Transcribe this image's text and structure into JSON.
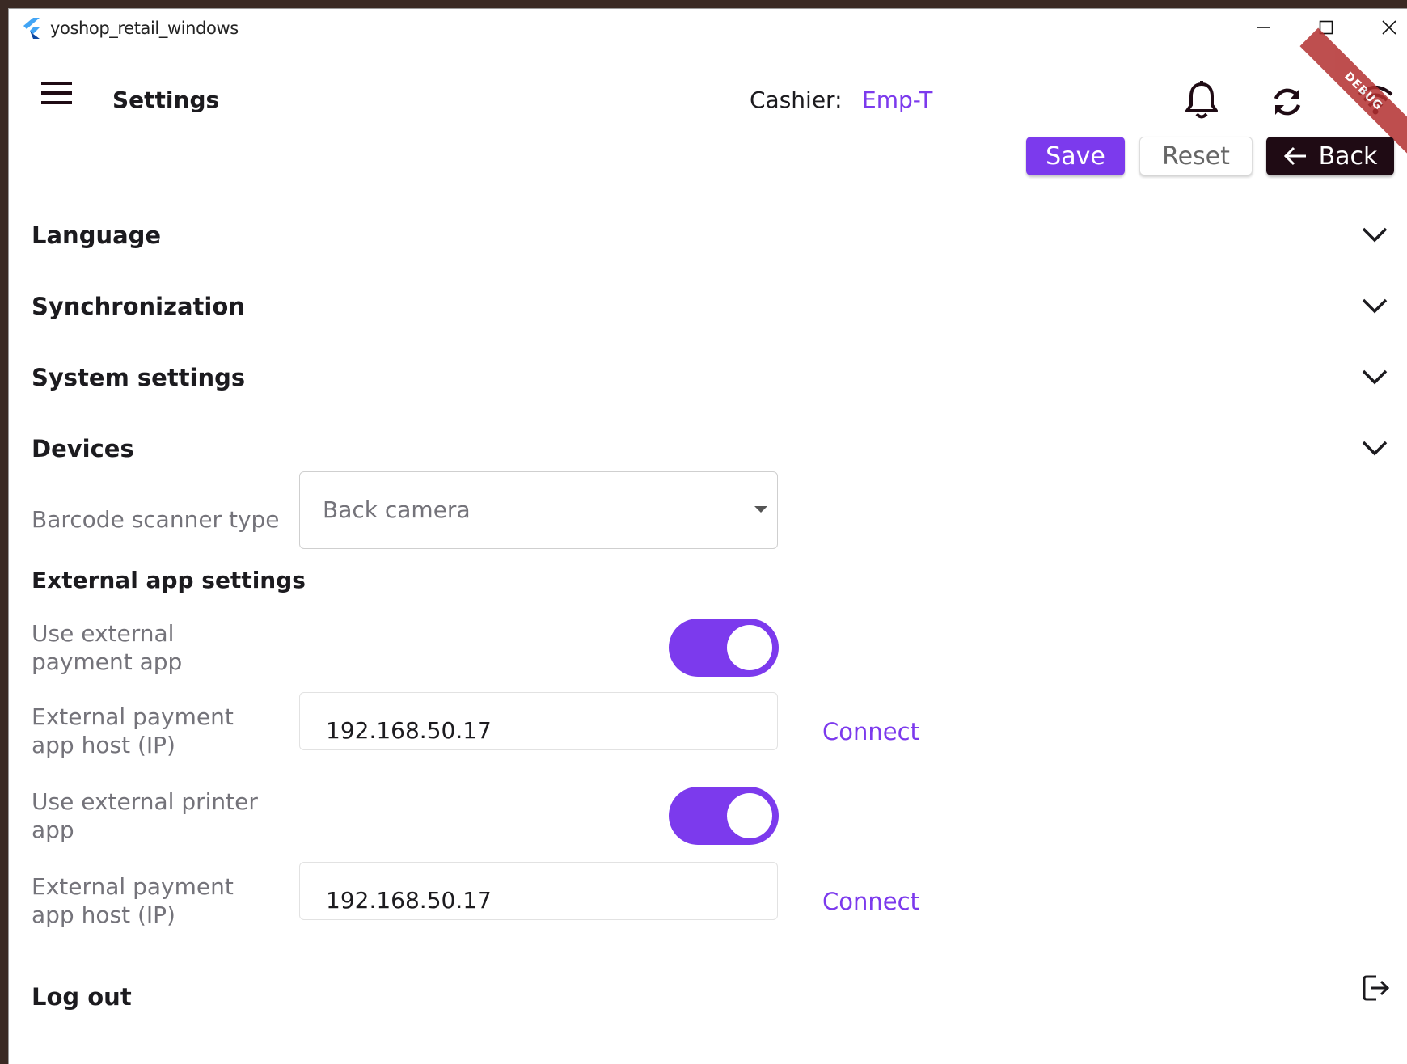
{
  "window": {
    "title": "yoshop_retail_windows",
    "minimize_icon": "minimize-icon",
    "maximize_icon": "maximize-icon",
    "close_icon": "close-icon"
  },
  "appbar": {
    "page_title": "Settings",
    "cashier_label": "Cashier:",
    "cashier_value": "Emp-T",
    "debug_ribbon": "DEBUG",
    "icons": [
      "menu-icon",
      "bell-icon",
      "sync-icon",
      "wifi-icon"
    ]
  },
  "actions": {
    "save": "Save",
    "reset": "Reset",
    "back": "Back"
  },
  "sections": {
    "language": "Language",
    "synchronization": "Synchronization",
    "system_settings": "System settings",
    "devices": "Devices",
    "logout": "Log out"
  },
  "devices": {
    "barcode_label": "Barcode scanner type",
    "barcode_value": "Back camera",
    "external_heading": "External app settings",
    "use_payment_label": "Use external payment app",
    "use_payment_on": true,
    "payment_host_label": "External payment app host (IP)",
    "payment_host_value": "192.168.50.17",
    "connect_label_1": "Connect",
    "use_printer_label": "Use external printer app",
    "use_printer_on": true,
    "printer_host_label": "External payment app host (IP)",
    "printer_host_value": "192.168.50.17",
    "connect_label_2": "Connect"
  },
  "colors": {
    "accent": "#7c3aed",
    "back_button": "#1f0b14",
    "text": "#1c1b1f",
    "muted": "#74737a"
  }
}
